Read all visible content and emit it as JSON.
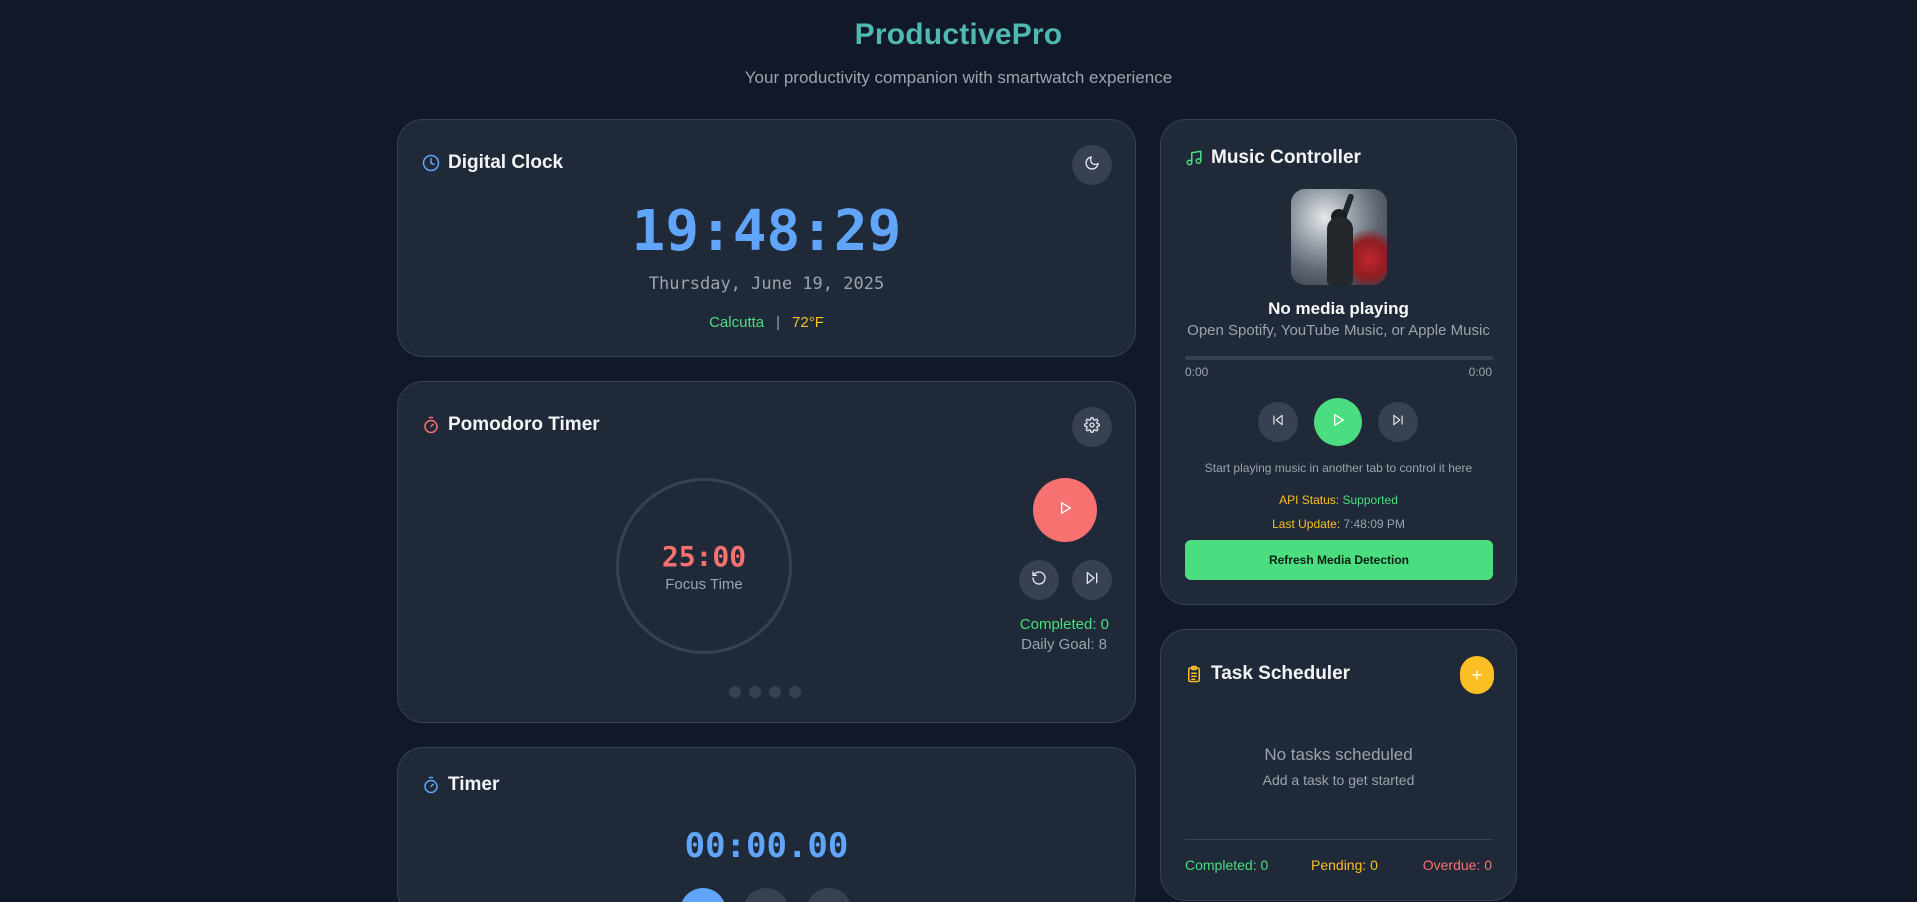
{
  "header": {
    "title": "ProductivePro",
    "subtitle": "Your productivity companion with smartwatch experience"
  },
  "clock": {
    "title": "Digital Clock",
    "time": "19:48:29",
    "date": "Thursday, June 19, 2025",
    "city": "Calcutta",
    "separator": "|",
    "temperature": "72°F",
    "icons": {
      "title": "clock-icon",
      "theme_toggle": "moon-icon"
    }
  },
  "pomodoro": {
    "title": "Pomodoro Timer",
    "time": "25:00",
    "mode_label": "Focus Time",
    "completed_label": "Completed: 0",
    "daily_goal_label": "Daily Goal: 8",
    "session_dot_count": 4,
    "icons": {
      "title": "stopwatch-icon",
      "settings": "gear-icon",
      "play": "play-icon",
      "reset": "reset-icon",
      "skip": "skip-forward-icon"
    }
  },
  "timer": {
    "title": "Timer",
    "time": "00:00.00",
    "icons": {
      "title": "stopwatch-icon"
    }
  },
  "music": {
    "title": "Music Controller",
    "track_title": "No media playing",
    "track_subtitle": "Open Spotify, YouTube Music, or Apple Music",
    "progress": 0,
    "elapsed": "0:00",
    "duration": "0:00",
    "hint": "Start playing music in another tab to control it here",
    "api_status_label": "API Status:",
    "api_status_value": "Supported",
    "last_update_label": "Last Update:",
    "last_update_value": "7:48:09 PM",
    "refresh_label": "Refresh Media Detection",
    "icons": {
      "title": "music-note-icon",
      "previous": "skip-back-icon",
      "play": "play-icon",
      "next": "skip-forward-icon"
    }
  },
  "tasks": {
    "title": "Task Scheduler",
    "add_label": "+",
    "empty_title": "No tasks scheduled",
    "empty_subtitle": "Add a task to get started",
    "completed_label": "Completed: 0",
    "pending_label": "Pending: 0",
    "overdue_label": "Overdue: 0",
    "icons": {
      "title": "clipboard-icon"
    }
  },
  "colors": {
    "background": "#111827",
    "card": "#1f2937",
    "accent_blue": "#60a5fa",
    "accent_red": "#f87171",
    "accent_green": "#4ade80",
    "accent_yellow": "#fbbf24",
    "title_teal": "#4fb8b0"
  }
}
